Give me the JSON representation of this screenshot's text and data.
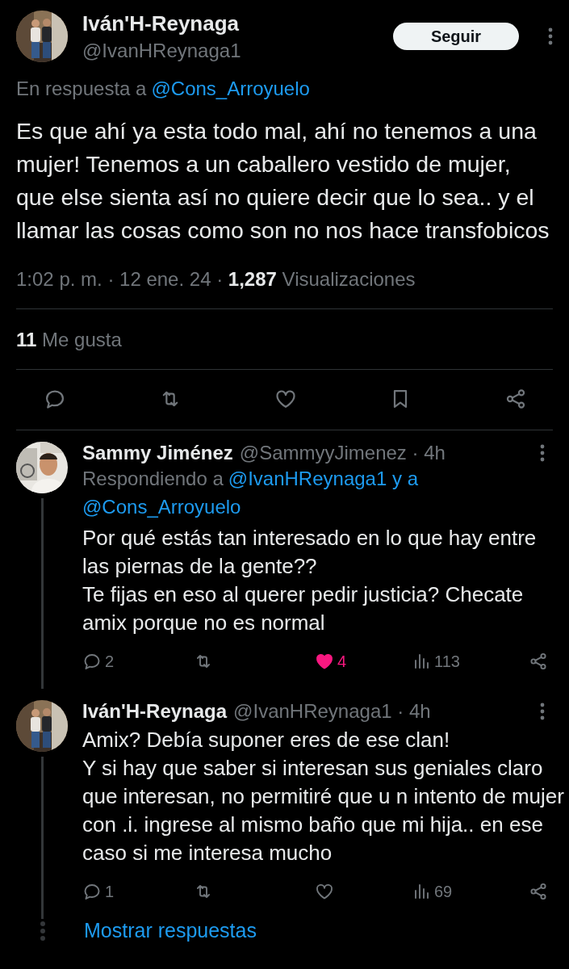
{
  "main_tweet": {
    "author": {
      "name": "Iván'H-Reynaga",
      "handle": "@IvanHReynaga1"
    },
    "follow_button": "Seguir",
    "reply_to": {
      "label": "En respuesta a",
      "mention": "@Cons_Arroyuelo"
    },
    "text": "Es que ahí ya esta todo mal, ahí no tenemos a una mujer! Tenemos a un caballero vestido de mujer,  que else sienta así no quiere decir que lo sea.. y el llamar las cosas como son no nos hace transfobicos",
    "meta": "1:02 p. m. · 12 ene. 24 · **1,287** Visualizaciones",
    "likes": "**11** Me gusta"
  },
  "replies": [
    {
      "name": "Sammy Jiménez",
      "handle": "@SammyyJimenez · 4h",
      "replying_to": {
        "label": "Respondiendo a",
        "mentions": [
          "@IvanHReynaga1 y a",
          "@Cons_Arroyuelo"
        ]
      },
      "text": "Por qué estás tan interesado en lo que hay entre las piernas de la gente??\nTe fijas en eso al querer pedir justicia? Checate amix porque no es normal",
      "replies": "2",
      "likes": "4",
      "liked": true,
      "views": "113"
    },
    {
      "name": "Iván'H-Reynaga",
      "handle": "@IvanHReynaga1 · 4h",
      "text": "Amix? Debía suponer eres de ese clan!\nY si hay que saber si interesan sus geniales claro que interesan, no permitiré que u n intento de mujer con .i. ingrese al mismo baño que mi hija.. en ese caso si me interesa mucho",
      "replies": "1",
      "liked": false,
      "views": "69"
    }
  ],
  "show_replies": "Mostrar respuestas"
}
